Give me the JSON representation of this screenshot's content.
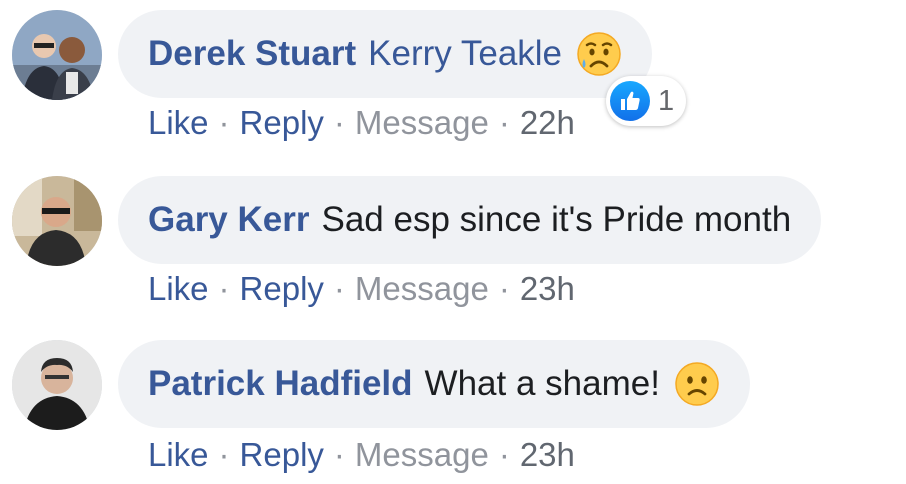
{
  "comments": [
    {
      "author": "Derek Stuart",
      "text": "Kerry Teakle",
      "emoji": "sad-tear-face",
      "actions": {
        "like": "Like",
        "reply": "Reply",
        "message": "Message",
        "time": "22h"
      },
      "reaction": {
        "icon": "thumbs-up-icon",
        "count": "1"
      }
    },
    {
      "author": "Gary Kerr",
      "text": "Sad esp since it's Pride month",
      "actions": {
        "like": "Like",
        "reply": "Reply",
        "message": "Message",
        "time": "23h"
      }
    },
    {
      "author": "Patrick Hadfield",
      "text": "What a shame!",
      "emoji": "frowning-face",
      "actions": {
        "like": "Like",
        "reply": "Reply",
        "message": "Message",
        "time": "23h"
      }
    }
  ],
  "separator": "·",
  "colors": {
    "link": "#385898",
    "muted": "#90949c",
    "bubble": "#f0f2f5",
    "like_blue": "#1877f2"
  }
}
